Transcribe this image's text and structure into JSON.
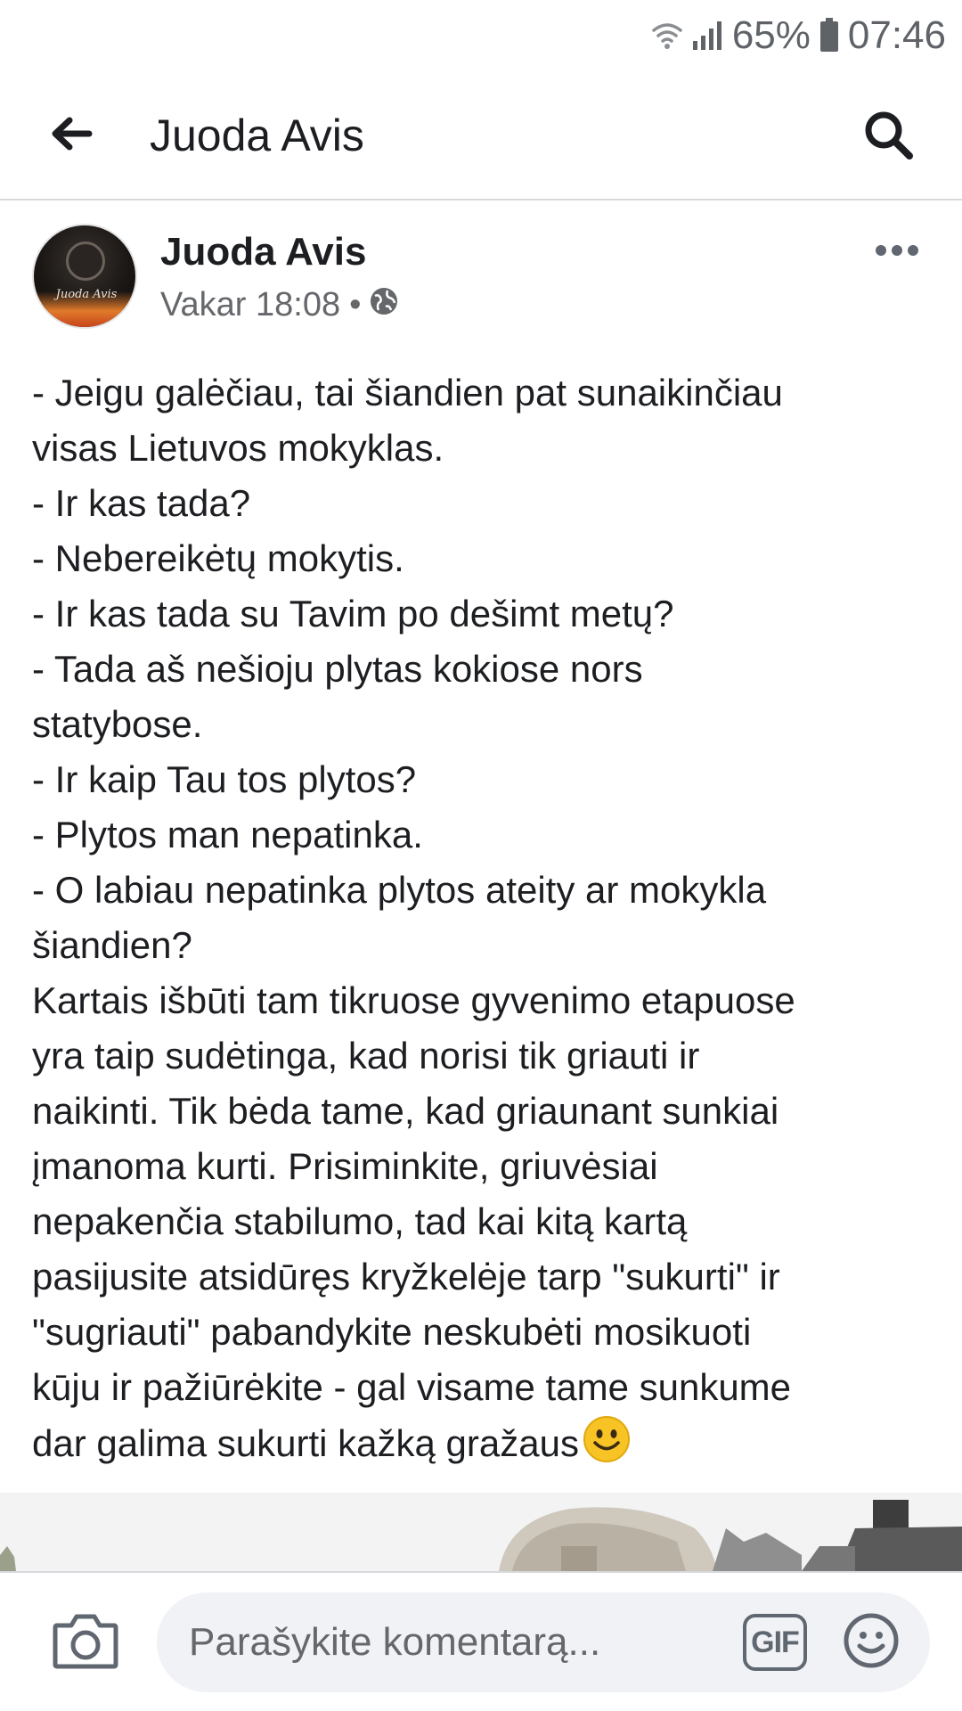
{
  "status_bar": {
    "battery": "65%",
    "time": "07:46"
  },
  "header": {
    "title": "Juoda Avis"
  },
  "post": {
    "author": "Juoda Avis",
    "avatar_text": "Juoda Avis",
    "timestamp": "Vakar 18:08",
    "separator": "•",
    "lines": [
      "- Jeigu galėčiau, tai šiandien pat sunaikinčiau",
      "visas Lietuvos mokyklas.",
      "- Ir kas tada?",
      "- Nebereikėtų mokytis.",
      "- Ir kas tada su Tavim po dešimt metų?",
      "- Tada aš nešioju plytas kokiose nors",
      "statybose.",
      "- Ir kaip Tau tos plytos?",
      "- Plytos man nepatinka.",
      "- O labiau nepatinka plytos ateity ar mokykla",
      "šiandien?",
      "Kartais išbūti tam tikruose gyvenimo etapuose",
      "yra taip sudėtinga, kad norisi tik griauti ir",
      "naikinti. Tik bėda tame, kad griaunant sunkiai",
      "įmanoma kurti. Prisiminkite, griuvėsiai",
      "nepakenčia stabilumo, tad kai kitą kartą",
      "pasijusite atsidūręs kryžkelėje tarp \"sukurti\" ir",
      "\"sugriauti\" pabandykite neskubėti mosikuoti",
      "kūju ir pažiūrėkite - gal visame tame sunkume",
      "dar galima sukurti kažką gražaus"
    ]
  },
  "comment_bar": {
    "placeholder": "Parašykite komentarą...",
    "gif_label": "GIF"
  },
  "icons": {
    "back": "arrow-left-icon",
    "search": "search-icon",
    "more": "more-horizontal-icon",
    "privacy": "globe-icon",
    "camera": "camera-icon",
    "emoji": "smiley-icon",
    "wifi": "wifi-icon",
    "signal": "signal-icon",
    "battery": "battery-icon"
  },
  "colors": {
    "text": "#1c1e21",
    "secondary_text": "#65676b",
    "divider": "#d7d9dc",
    "input_bg": "#f0f2f5"
  }
}
